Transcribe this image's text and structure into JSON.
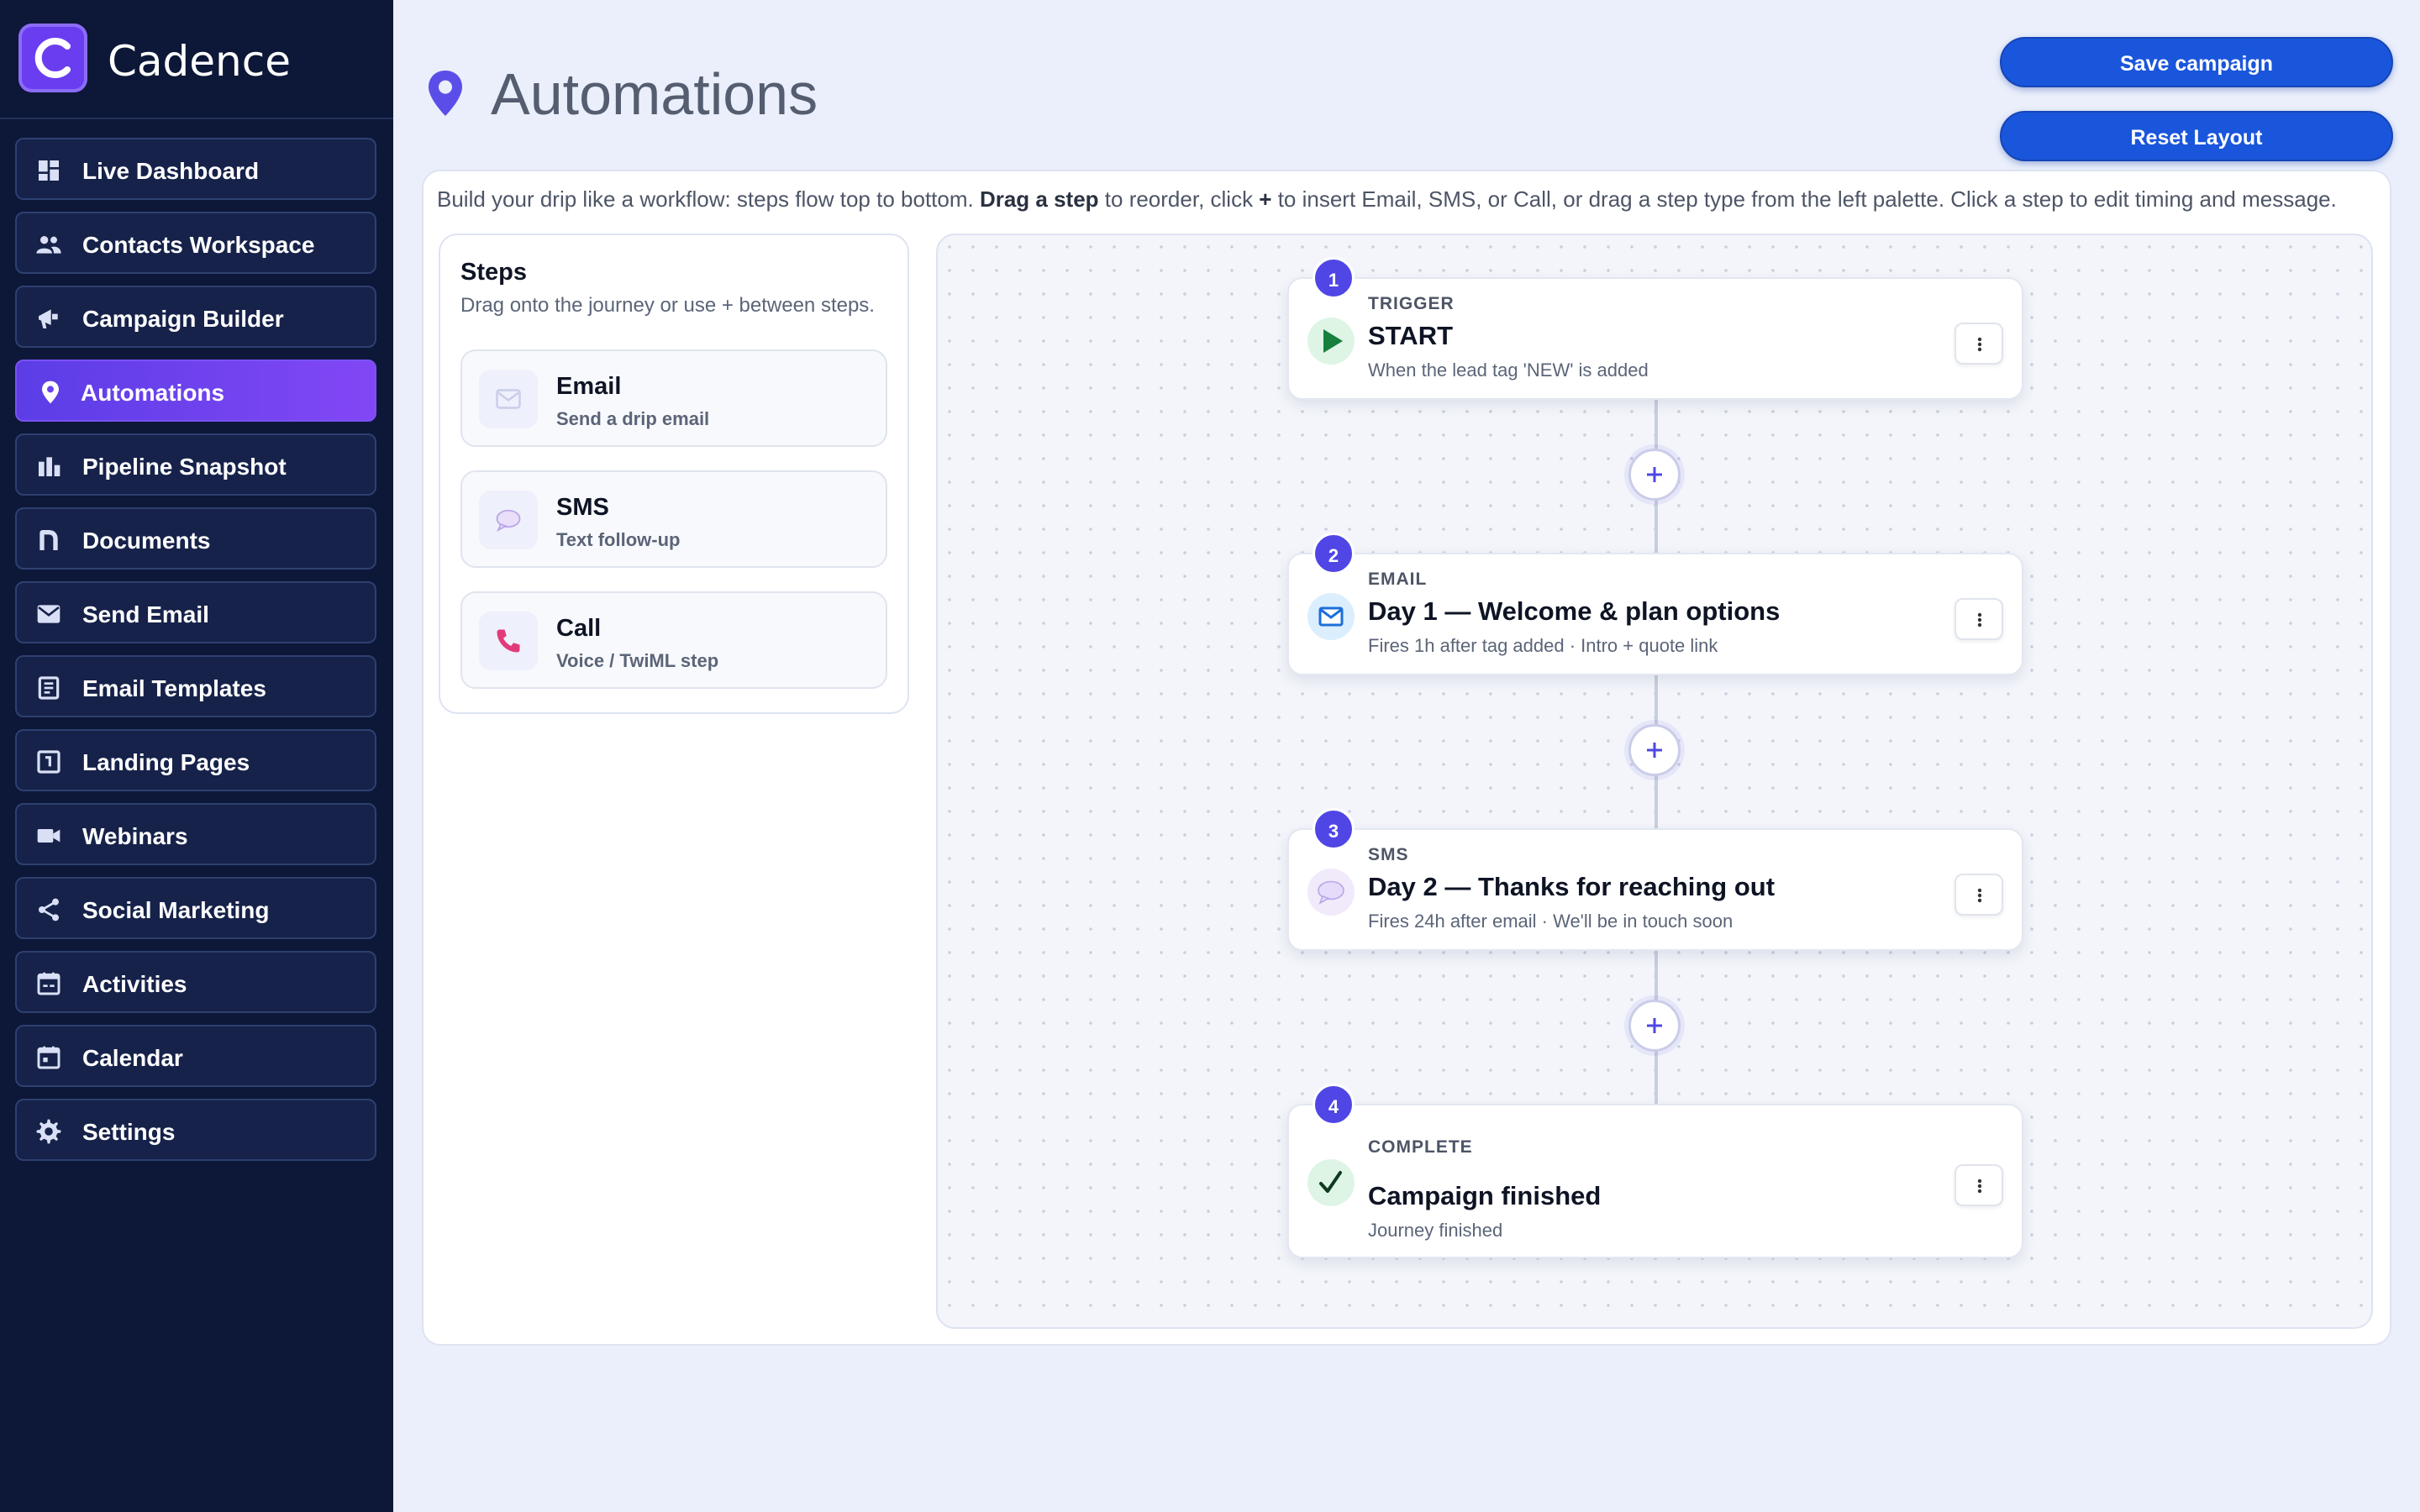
{
  "app": {
    "name": "Cadence"
  },
  "sidebar": {
    "items": [
      {
        "label": "Live Dashboard",
        "icon": "dashboard-icon"
      },
      {
        "label": "Contacts Workspace",
        "icon": "people-icon"
      },
      {
        "label": "Campaign Builder",
        "icon": "megaphone-icon"
      },
      {
        "label": "Automations",
        "icon": "location-pin-icon",
        "active": true
      },
      {
        "label": "Pipeline Snapshot",
        "icon": "bar-chart-icon"
      },
      {
        "label": "Documents",
        "icon": "document-icon"
      },
      {
        "label": "Send Email",
        "icon": "envelope-icon"
      },
      {
        "label": "Email Templates",
        "icon": "template-icon"
      },
      {
        "label": "Landing Pages",
        "icon": "page-icon"
      },
      {
        "label": "Webinars",
        "icon": "video-camera-icon"
      },
      {
        "label": "Social Marketing",
        "icon": "share-icon"
      },
      {
        "label": "Activities",
        "icon": "calendar-check-icon"
      },
      {
        "label": "Calendar",
        "icon": "calendar-icon"
      },
      {
        "label": "Settings",
        "icon": "gear-icon"
      }
    ]
  },
  "header": {
    "title": "Automations",
    "save_label": "Save campaign",
    "reset_label": "Reset Layout"
  },
  "instructions": {
    "part1": "Build your drip like a workflow: steps flow top to bottom. ",
    "bold1": "Drag a step",
    "part2": " to reorder, click ",
    "bold2": "+",
    "part3": " to insert Email, SMS, or Call, or drag a step type from the left palette. Click a step to edit timing and message."
  },
  "palette": {
    "title": "Steps",
    "hint": "Drag onto the journey or use + between steps.",
    "items": [
      {
        "name": "Email",
        "sub": "Send a drip email",
        "icon": "envelope-icon"
      },
      {
        "name": "SMS",
        "sub": "Text follow-up",
        "icon": "speech-bubble-icon"
      },
      {
        "name": "Call",
        "sub": "Voice / TwiML step",
        "icon": "phone-icon"
      }
    ]
  },
  "steps": [
    {
      "number": "1",
      "kind": "TRIGGER",
      "title": "START",
      "desc": "When the lead tag 'NEW' is added",
      "icon": "play-icon"
    },
    {
      "number": "2",
      "kind": "EMAIL",
      "title": "Day 1 — Welcome & plan options",
      "desc": "Fires 1h after tag added · Intro + quote link",
      "icon": "envelope-icon"
    },
    {
      "number": "3",
      "kind": "SMS",
      "title": "Day 2 — Thanks for reaching out",
      "desc": "Fires 24h after email · We'll be in touch soon",
      "icon": "speech-bubble-icon"
    },
    {
      "number": "4",
      "kind": "COMPLETE",
      "title": "Campaign finished",
      "desc": "Journey finished",
      "icon": "checkmark-icon"
    }
  ],
  "colors": {
    "sidebar_bg": "#0d1738",
    "active_nav": "#6b44f0",
    "primary_button": "#1a56db",
    "step_badge": "#4f46e5",
    "page_bg": "#eaeffb"
  }
}
